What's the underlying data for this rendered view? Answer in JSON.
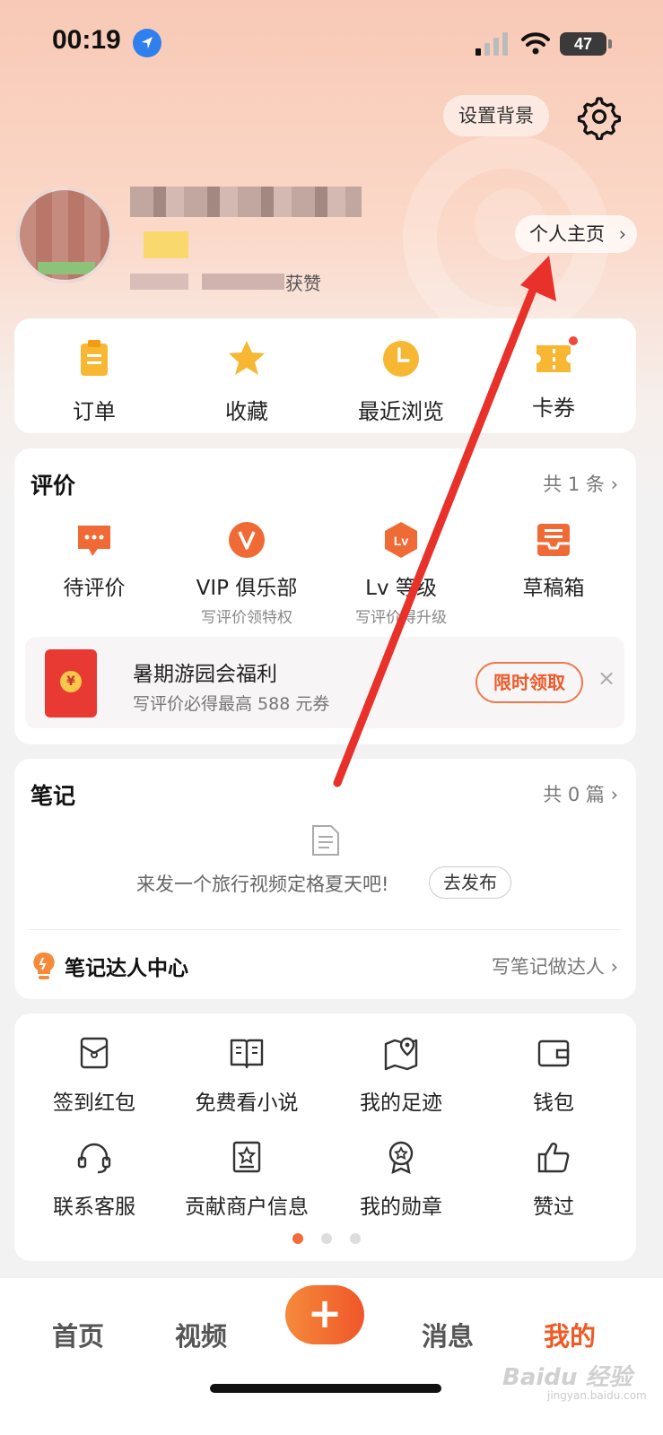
{
  "status_bar": {
    "time": "00:19",
    "battery": "47"
  },
  "header": {
    "set_background_label": "设置背景",
    "settings_icon": "gear-icon",
    "homepage_label": "个人主页",
    "stat_suffix": "获赞"
  },
  "quick_actions": [
    {
      "label": "订单",
      "icon": "order-clipboard-icon"
    },
    {
      "label": "收藏",
      "icon": "star-icon"
    },
    {
      "label": "最近浏览",
      "icon": "clock-icon"
    },
    {
      "label": "卡券",
      "icon": "ticket-icon",
      "badge": true
    }
  ],
  "reviews": {
    "title": "评价",
    "count": "共 1 条",
    "items": [
      {
        "label": "待评价",
        "sub": "",
        "icon": "chat-bubble-icon"
      },
      {
        "label": "VIP 俱乐部",
        "sub": "写评价领特权",
        "icon": "vip-icon"
      },
      {
        "label": "Lv 等级",
        "sub": "写评价得升级",
        "icon": "level-icon"
      },
      {
        "label": "草稿箱",
        "sub": "",
        "icon": "draft-box-icon"
      }
    ],
    "promo": {
      "title": "暑期游园会福利",
      "subtitle": "写评价必得最高 588 元券",
      "button": "限时领取",
      "close": "×"
    }
  },
  "notes": {
    "title": "笔记",
    "count": "共 0 篇",
    "empty_prompt": "来发一个旅行视频定格夏天吧!",
    "publish_button": "去发布",
    "talent_title": "笔记达人中心",
    "talent_link": "写笔记做达人"
  },
  "tools": [
    {
      "label": "签到红包",
      "icon": "red-envelope-icon"
    },
    {
      "label": "免费看小说",
      "icon": "book-icon"
    },
    {
      "label": "我的足迹",
      "icon": "map-pin-icon"
    },
    {
      "label": "钱包",
      "icon": "wallet-icon"
    },
    {
      "label": "联系客服",
      "icon": "headset-icon"
    },
    {
      "label": "贡献商户信息",
      "icon": "store-info-icon"
    },
    {
      "label": "我的勋章",
      "icon": "medal-icon"
    },
    {
      "label": "赞过",
      "icon": "thumbs-up-icon"
    }
  ],
  "bottom_nav": {
    "home": "首页",
    "video": "视频",
    "plus": "+",
    "messages": "消息",
    "mine": "我的"
  },
  "watermark": {
    "brand": "Baidu 经验",
    "url": "jingyan.baidu.com"
  },
  "colors": {
    "accent": "#f05a24",
    "arrow": "#e8312a"
  }
}
